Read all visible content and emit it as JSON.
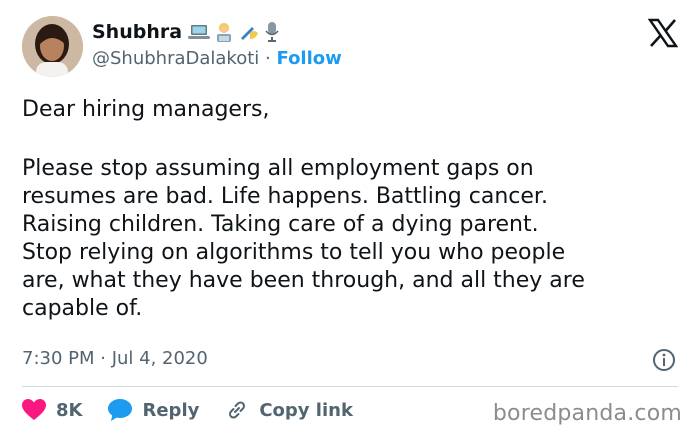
{
  "author": {
    "name": "Shubhra",
    "name_emojis": [
      "laptop-emoji",
      "woman-technologist-emoji",
      "writing-hand-emoji",
      "microphone-emoji"
    ],
    "handle": "@ShubhraDalakoti",
    "separator": "·",
    "follow_label": "Follow"
  },
  "tweet": {
    "greeting": "Dear hiring managers,",
    "body": "Please stop assuming all employment gaps on\nresumes are bad. Life happens. Battling cancer.\nRaising children. Taking care of a dying parent.\nStop relying on algorithms to tell you who people\nare, what they have been through, and all they are\ncapable of."
  },
  "meta": {
    "time": "7:30 PM · Jul 4, 2020"
  },
  "actions": {
    "likes_count": "8K",
    "reply_label": "Reply",
    "copy_link_label": "Copy link"
  },
  "watermark": "boredpanda.com",
  "colors": {
    "accent": "#1d9bf0",
    "heart": "#f91880",
    "text": "#0f1419",
    "muted": "#536471"
  }
}
